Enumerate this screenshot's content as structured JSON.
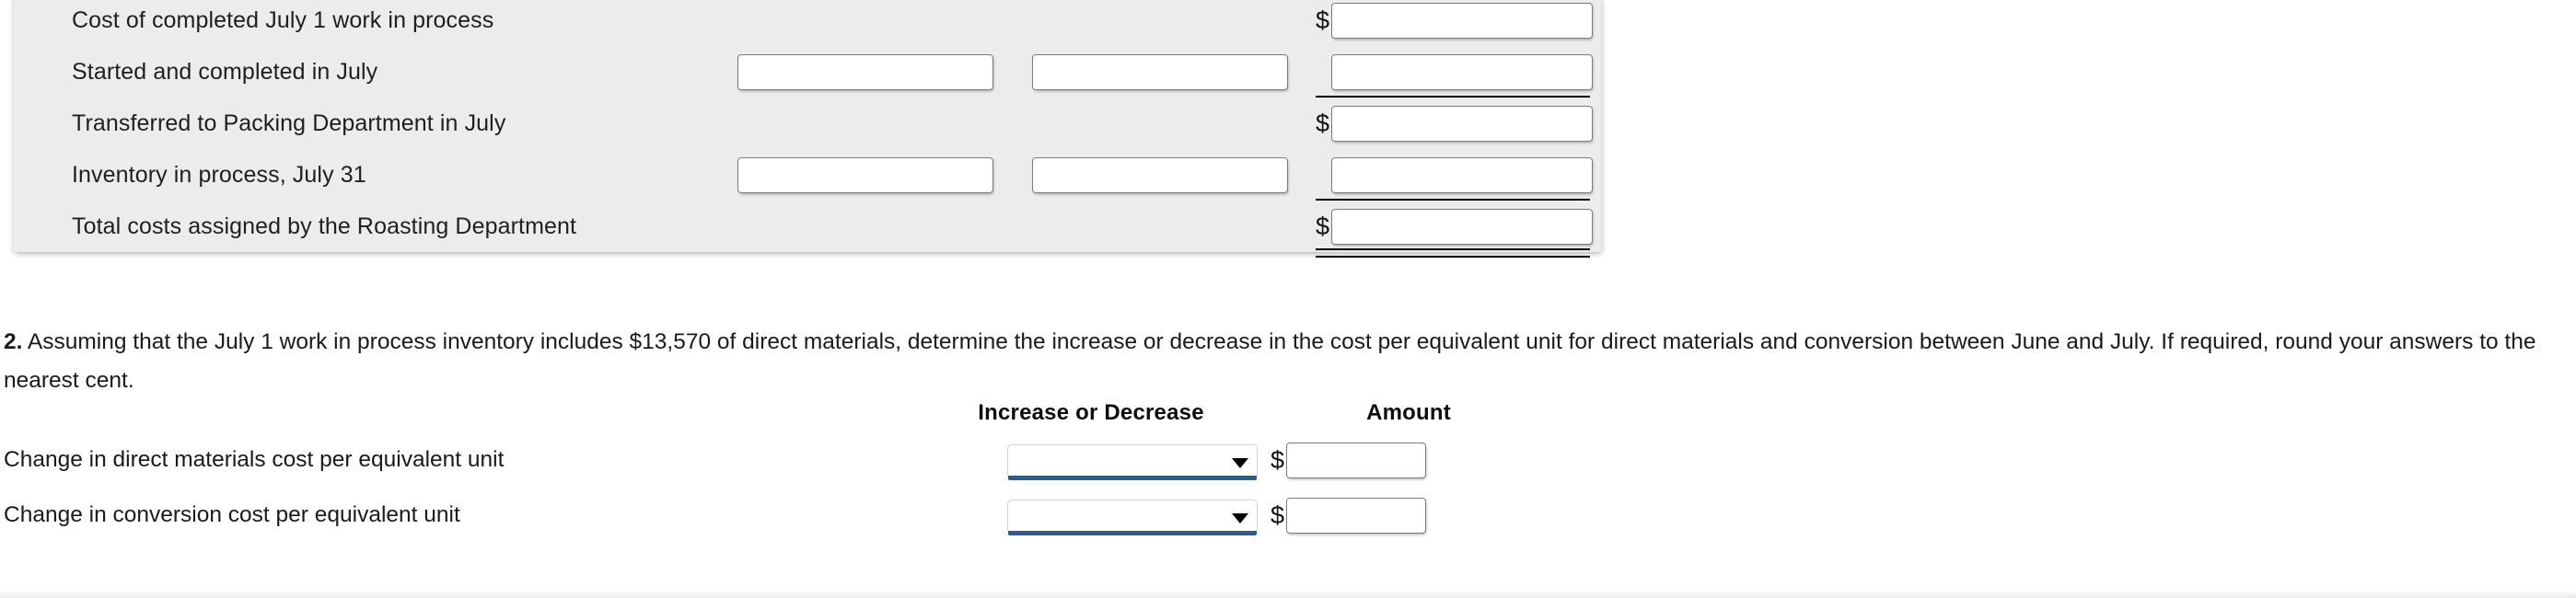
{
  "cost_table": {
    "rows": [
      {
        "label": "Cost of completed July 1 work in process",
        "mid1": null,
        "mid2": null,
        "total_prefix": "$",
        "total_value": "",
        "rule": "none"
      },
      {
        "label": "Started and completed in July",
        "mid1": "",
        "mid2": "",
        "total_prefix": "",
        "total_value": "",
        "rule": "single"
      },
      {
        "label": "Transferred to Packing Department in July",
        "mid1": null,
        "mid2": null,
        "total_prefix": "$",
        "total_value": "",
        "rule": "none"
      },
      {
        "label": "Inventory in process, July 31",
        "mid1": "",
        "mid2": "",
        "total_prefix": "",
        "total_value": "",
        "rule": "single"
      },
      {
        "label": "Total costs assigned by the Roasting Department",
        "mid1": null,
        "mid2": null,
        "total_prefix": "$",
        "total_value": "",
        "rule": "double"
      }
    ]
  },
  "question2": {
    "number": "2.",
    "text": "Assuming that the July 1 work in process inventory includes $13,570 of direct materials, determine the increase or decrease in the cost per equivalent unit for direct materials and conversion between June and July. If required, round your answers to the nearest cent.",
    "mentioned_amount": "$13,570"
  },
  "answer_table": {
    "headers": {
      "label": "",
      "increase_or_decrease": "Increase or Decrease",
      "amount": "Amount"
    },
    "rows": [
      {
        "label": "Change in direct materials cost per equivalent unit",
        "select_value": "",
        "amount_prefix": "$",
        "amount_value": ""
      },
      {
        "label": "Change in conversion cost per equivalent unit",
        "select_value": "",
        "amount_prefix": "$",
        "amount_value": ""
      }
    ]
  },
  "icons": {
    "dropdown_caret": "chevron-down-icon"
  },
  "colors": {
    "panel_background": "#ececec",
    "page_background": "#ffffff",
    "input_border": "#7b7b7b",
    "select_underline": "#2e5c8a",
    "rule": "#000000",
    "text": "#1a1a1a"
  }
}
